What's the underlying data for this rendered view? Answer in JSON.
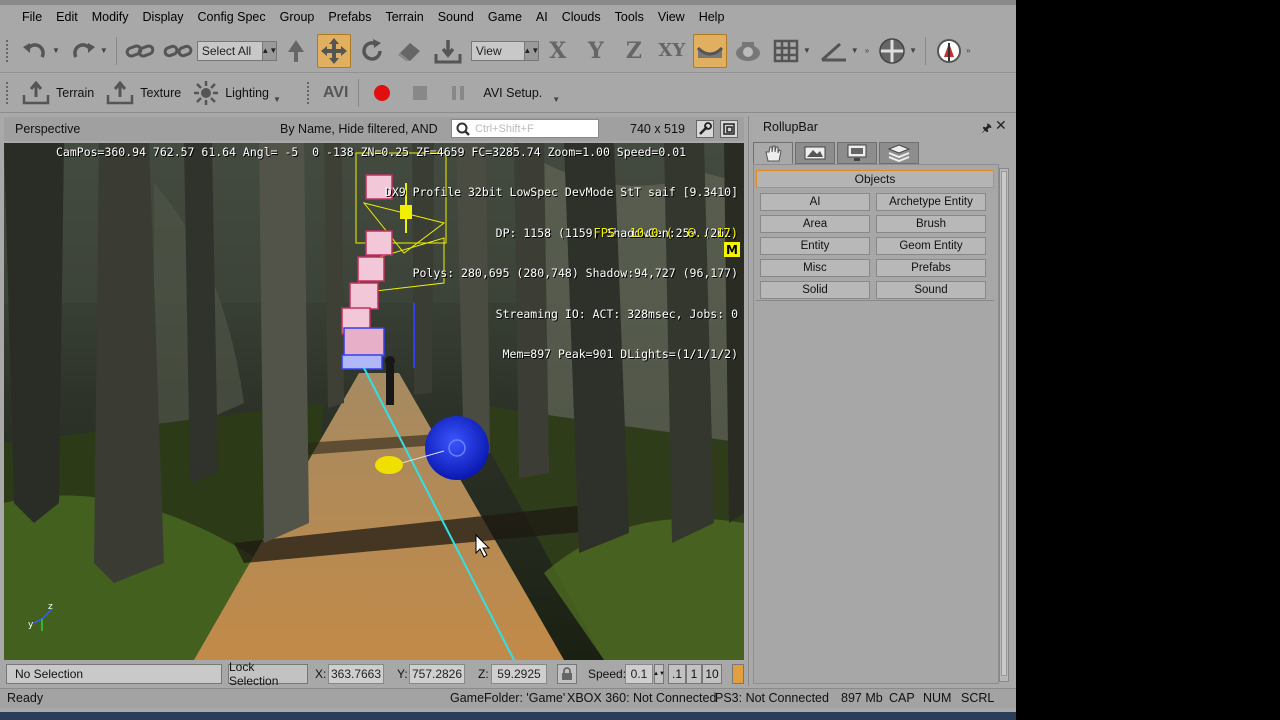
{
  "menu": [
    "File",
    "Edit",
    "Modify",
    "Display",
    "Config Spec",
    "Group",
    "Prefabs",
    "Terrain",
    "Sound",
    "Game",
    "AI",
    "Clouds",
    "Tools",
    "View",
    "Help"
  ],
  "toolbar1": {
    "select_combo": "Select All",
    "view_combo": "View",
    "axes": [
      "X",
      "Y",
      "Z",
      "XY"
    ]
  },
  "toolbar2": {
    "terrain_label": "Terrain",
    "texture_label": "Texture",
    "lighting_label": "Lighting",
    "avi_label": "AVI",
    "avi_setup_label": "AVI Setup."
  },
  "viewport": {
    "title": "Perspective",
    "filter": "By Name, Hide filtered, AND",
    "search_placeholder": "Ctrl+Shift+F",
    "resolution": "740 x 519",
    "hud_campos": "CamPos=360.94 762.57 61.64 Angl= -5  0 -138 ZN=0.25 ZF=4659 FC=3285.74 Zoom=1.00 Speed=0.01",
    "hud_lines": [
      "DX9 Profile 32bit LowSpec DevMode StT saif [9.3410]",
      "DP: 1158 (1159) ShadowGen:259 (262)",
      "Polys: 280,695 (280,748) Shadow:94,727 (96,177)",
      "Streaming IO: ACT: 328msec, Jobs: 0",
      "Mem=897 Peak=901 DLights=(1/1/1/2)"
    ],
    "hud_fps": "FPS  10.0 (  6.. 17)",
    "hud_marker": "M"
  },
  "coords": {
    "selection": "No Selection",
    "lock_label": "Lock Selection",
    "x_label": "X:",
    "x_value": "363.7663",
    "y_label": "Y:",
    "y_value": "757.2826",
    "z_label": "Z:",
    "z_value": "59.2925",
    "speed_label": "Speed:",
    "speed_value": "0.1",
    "speed_presets": [
      ".1",
      "1",
      "10"
    ]
  },
  "status": {
    "ready": "Ready",
    "game_folder": "GameFolder: 'Game'",
    "xbox": "XBOX 360: Not Connected",
    "ps3": "PS3: Not Connected",
    "memory": "897 Mb",
    "cap": "CAP",
    "num": "NUM",
    "scrl": "SCRL"
  },
  "rollup": {
    "title": "RollupBar",
    "section": "Objects",
    "buttons": [
      "AI",
      "Archetype Entity",
      "Area",
      "Brush",
      "Entity",
      "Geom Entity",
      "Misc",
      "Prefabs",
      "Solid",
      "Sound"
    ]
  },
  "colors": {
    "accent_active": "#e0b060",
    "section_border": "#e08a20",
    "hud_yellow": "#f4f400",
    "ui_gray": "#a8a8a8"
  }
}
